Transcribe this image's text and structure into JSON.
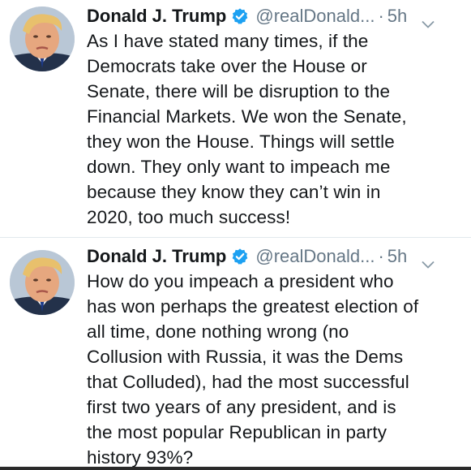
{
  "tweets": [
    {
      "display_name": "Donald J. Trump",
      "handle": "@realDonald...",
      "separator": "·",
      "time": "5h",
      "text": "As I have stated many times, if the\nDemocrats take over the House or\nSenate, there will be disruption to the\nFinancial Markets. We won the Senate,\nthey won the House. Things will settle\ndown. They only want to impeach me\nbecause they know they can’t win in\n2020, too much success!"
    },
    {
      "display_name": "Donald J. Trump",
      "handle": "@realDonald...",
      "separator": "·",
      "time": "5h",
      "text": "How do you impeach a president who\nhas won perhaps the greatest election of\nall time, done nothing wrong (no\nCollusion with Russia, it was the Dems\nthat Colluded), had the most successful\nfirst two years of any president, and is\nthe most popular Republican in party\nhistory 93%?"
    }
  ],
  "colors": {
    "text": "#14171a",
    "secondary": "#657786",
    "verified_badge": "#1da1f2",
    "divider": "#e1e8ed"
  },
  "icons": {
    "verified": "verified-badge-icon",
    "caret": "chevron-down-icon"
  }
}
